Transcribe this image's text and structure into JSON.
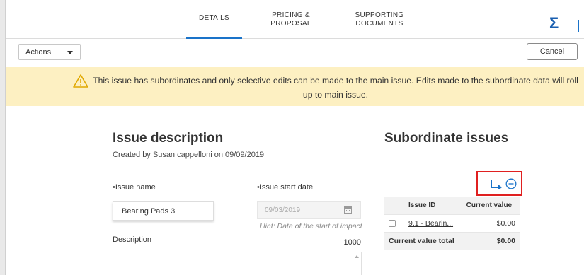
{
  "tabs": [
    {
      "label": "DETAILS",
      "active": true
    },
    {
      "label": "PRICING &\nPROPOSAL",
      "active": false
    },
    {
      "label": "SUPPORTING\nDOCUMENTS",
      "active": false
    }
  ],
  "header": {
    "sigma_symbol": "Σ"
  },
  "toolbar": {
    "actions_label": "Actions",
    "cancel_label": "Cancel"
  },
  "banner": {
    "text": "This issue has subordinates and only selective edits can be made to the main issue. Edits made to the subordinate data will roll up to main issue."
  },
  "issue_description": {
    "title": "Issue description",
    "created_by": "Created by Susan cappelloni on 09/09/2019",
    "issue_name_label": "Issue name",
    "issue_name_value": "Bearing Pads 3",
    "start_date_label": "Issue start date",
    "start_date_value": "09/03/2019",
    "start_date_hint": "Hint: Date of the start of impact",
    "description_label": "Description",
    "description_counter": "1000",
    "required_marker": "•"
  },
  "subordinate": {
    "title": "Subordinate issues",
    "columns": [
      "Issue ID",
      "Current value"
    ],
    "rows": [
      {
        "issue_id": "9.1 - Bearin...",
        "current_value": "$0.00"
      }
    ],
    "total_label": "Current value total",
    "total_value": "$0.00"
  },
  "colors": {
    "accent": "#1a73c9",
    "banner_bg": "#fdf0c2",
    "highlight": "#e02020"
  }
}
